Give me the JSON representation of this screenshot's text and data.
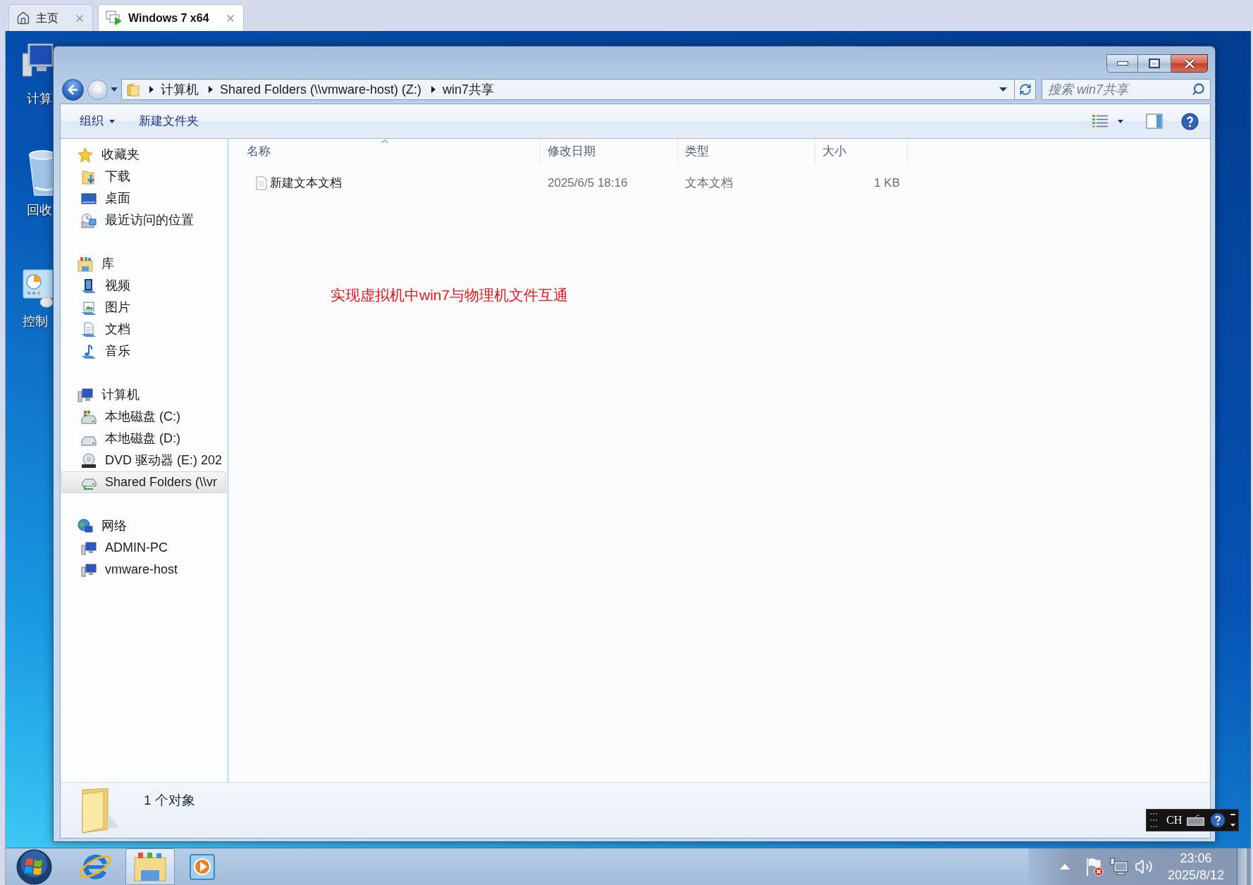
{
  "host_tabs": [
    {
      "label": "主页",
      "kind": "home",
      "selected": false
    },
    {
      "label": "Windows 7 x64",
      "kind": "vm",
      "selected": true
    }
  ],
  "desktop_icons": [
    {
      "label": "计算",
      "kind": "computer"
    },
    {
      "label": "回收",
      "kind": "recycle_bin"
    },
    {
      "label": "控制",
      "kind": "control_panel"
    }
  ],
  "explorer": {
    "breadcrumb": [
      "计算机",
      "Shared Folders (\\\\vmware-host) (Z:)",
      "win7共享"
    ],
    "search": {
      "placeholder": "搜索 win7共享"
    },
    "toolbar": [
      {
        "label": "组织",
        "menu": true
      },
      {
        "label": "新建文件夹",
        "menu": false
      }
    ],
    "nav": [
      {
        "label": "收藏夹",
        "kind": "favorites",
        "selected": false,
        "children": [
          {
            "label": "下载",
            "kind": "downloads",
            "selected": false
          },
          {
            "label": "桌面",
            "kind": "desktop",
            "selected": false
          },
          {
            "label": "最近访问的位置",
            "kind": "recent",
            "selected": false
          }
        ]
      },
      {
        "label": "库",
        "kind": "library",
        "selected": false,
        "children": [
          {
            "label": "视频",
            "kind": "videos",
            "selected": false
          },
          {
            "label": "图片",
            "kind": "pictures",
            "selected": false
          },
          {
            "label": "文档",
            "kind": "documents",
            "selected": false
          },
          {
            "label": "音乐",
            "kind": "music",
            "selected": false
          }
        ]
      },
      {
        "label": "计算机",
        "kind": "computer",
        "selected": false,
        "children": [
          {
            "label": "本地磁盘 (C:)",
            "kind": "drive_windows",
            "selected": false
          },
          {
            "label": "本地磁盘 (D:)",
            "kind": "drive",
            "selected": false
          },
          {
            "label": "DVD 驱动器 (E:) 202",
            "kind": "dvd",
            "selected": false
          },
          {
            "label": "Shared Folders (\\\\vr",
            "kind": "network_drive",
            "selected": true
          }
        ]
      },
      {
        "label": "网络",
        "kind": "network",
        "selected": false,
        "children": [
          {
            "label": "ADMIN-PC",
            "kind": "pc",
            "selected": false
          },
          {
            "label": "vmware-host",
            "kind": "pc",
            "selected": false
          }
        ]
      }
    ],
    "columns": [
      {
        "label": "名称",
        "sorted": true
      },
      {
        "label": "修改日期",
        "sorted": false
      },
      {
        "label": "类型",
        "sorted": false
      },
      {
        "label": "大小",
        "sorted": false
      }
    ],
    "files": [
      {
        "name": "新建文本文档",
        "modified": "2025/6/5 18:16",
        "type": "文本文档",
        "size": "1 KB"
      }
    ],
    "annotation": "实现虚拟机中win7与物理机文件互通",
    "status": "1 个对象"
  },
  "language_bar": {
    "label": "CH"
  },
  "taskbar": {
    "apps": [
      {
        "kind": "browser",
        "active": false
      },
      {
        "kind": "explorer",
        "active": true
      },
      {
        "kind": "media_player",
        "active": false
      }
    ],
    "clock": {
      "time": "23:06",
      "date": "2025/8/12"
    }
  }
}
